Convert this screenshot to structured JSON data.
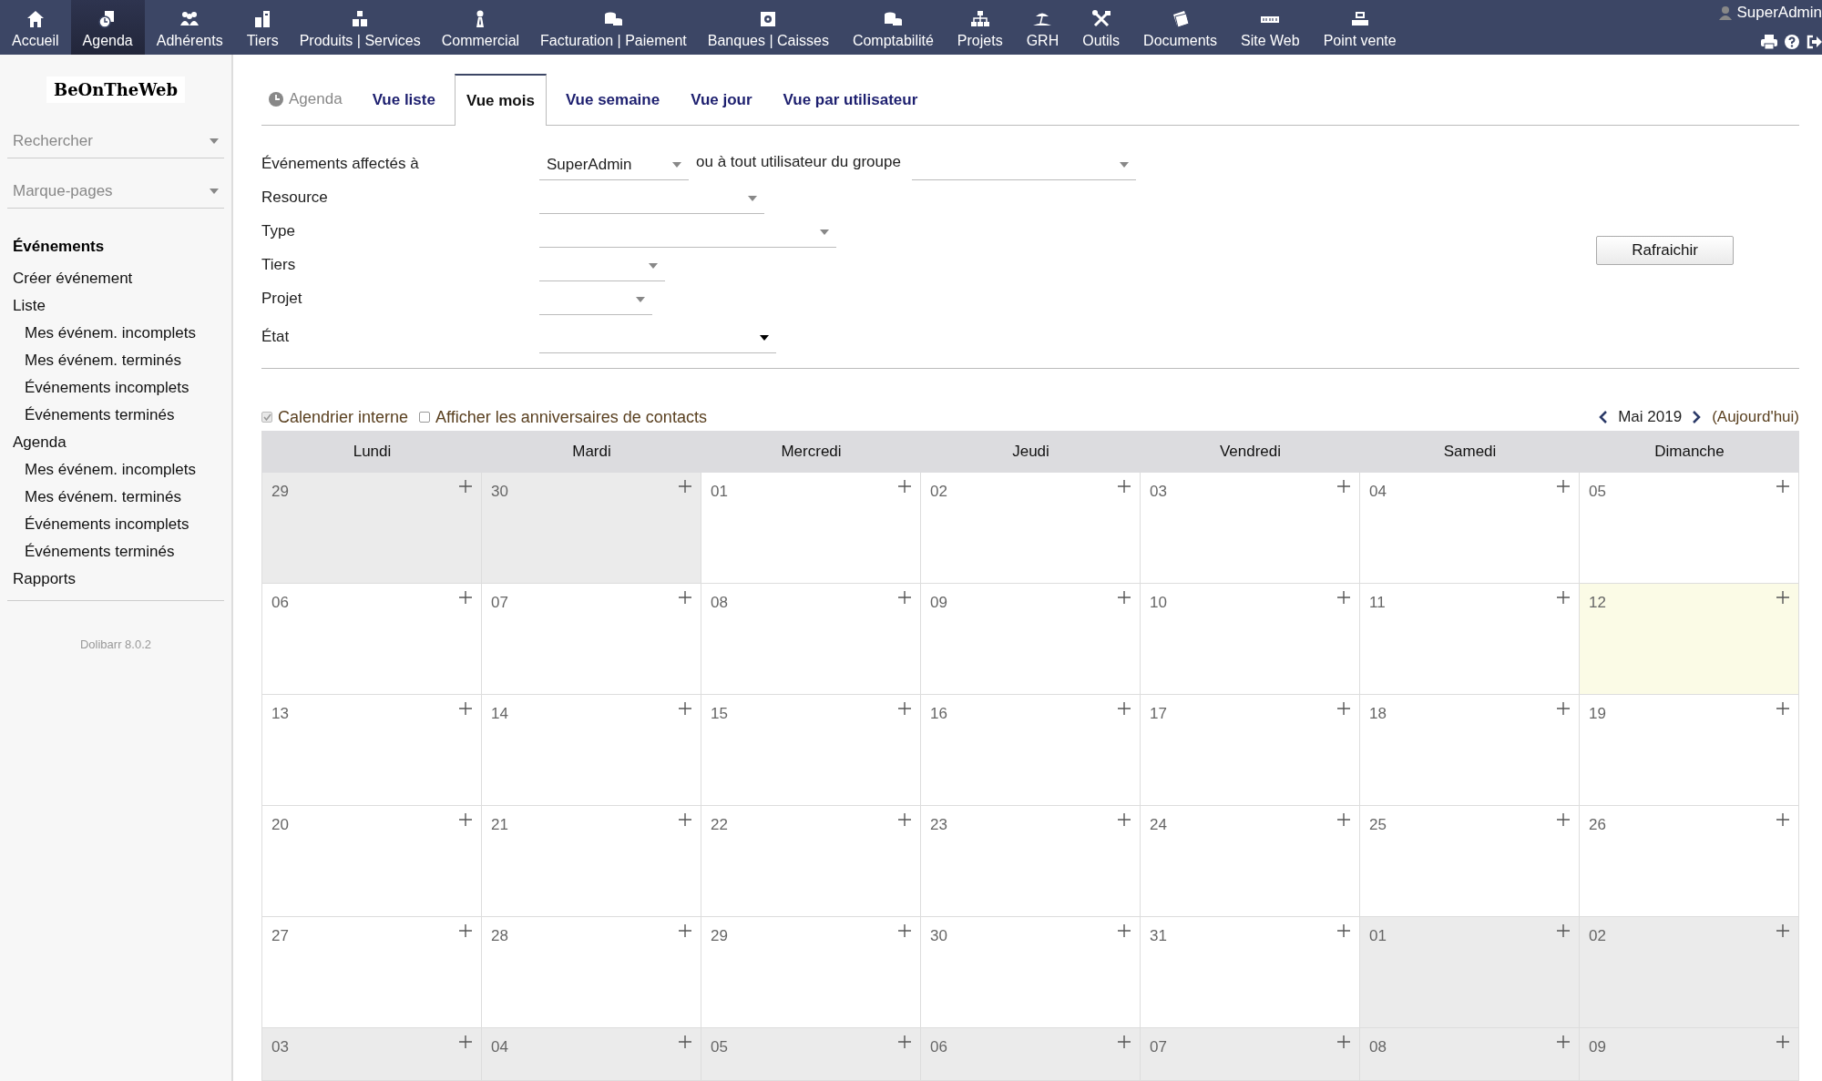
{
  "top_menu": [
    {
      "label": "Accueil",
      "selected": false
    },
    {
      "label": "Agenda",
      "selected": true
    },
    {
      "label": "Adhérents",
      "selected": false
    },
    {
      "label": "Tiers",
      "selected": false
    },
    {
      "label": "Produits | Services",
      "selected": false
    },
    {
      "label": "Commercial",
      "selected": false
    },
    {
      "label": "Facturation | Paiement",
      "selected": false
    },
    {
      "label": "Banques | Caisses",
      "selected": false
    },
    {
      "label": "Comptabilité",
      "selected": false
    },
    {
      "label": "Projets",
      "selected": false
    },
    {
      "label": "GRH",
      "selected": false
    },
    {
      "label": "Outils",
      "selected": false
    },
    {
      "label": "Documents",
      "selected": false
    },
    {
      "label": "Site Web",
      "selected": false
    },
    {
      "label": "Point vente",
      "selected": false
    }
  ],
  "user": {
    "name": "SuperAdmin"
  },
  "sidebar": {
    "logo": "BeOnTheWeb",
    "search": {
      "placeholder": "Rechercher"
    },
    "bookmarks": {
      "placeholder": "Marque-pages"
    },
    "heading": "Événements",
    "items": [
      {
        "label": "Créer événement"
      },
      {
        "label": "Liste",
        "children": [
          {
            "label": "Mes événem. incomplets"
          },
          {
            "label": "Mes événem. terminés"
          },
          {
            "label": "Événements incomplets"
          },
          {
            "label": "Événements terminés"
          }
        ]
      },
      {
        "label": "Agenda",
        "children": [
          {
            "label": "Mes événem. incomplets"
          },
          {
            "label": "Mes événem. terminés"
          },
          {
            "label": "Événements incomplets"
          },
          {
            "label": "Événements terminés"
          }
        ]
      },
      {
        "label": "Rapports"
      }
    ],
    "version": "Dolibarr 8.0.2"
  },
  "tabs_title": "Agenda",
  "tabs": [
    {
      "label": "Vue liste",
      "selected": false
    },
    {
      "label": "Vue mois",
      "selected": true
    },
    {
      "label": "Vue semaine",
      "selected": false
    },
    {
      "label": "Vue jour",
      "selected": false
    },
    {
      "label": "Vue par utilisateur",
      "selected": false
    }
  ],
  "filters": [
    {
      "label": "Événements affectés à",
      "value": "SuperAdmin",
      "extra_label": "ou à tout utilisateur du groupe"
    },
    {
      "label": "Resource"
    },
    {
      "label": "Type"
    },
    {
      "label": "Tiers"
    },
    {
      "label": "Projet"
    },
    {
      "label": "État"
    }
  ],
  "refresh_button": "Rafraichir",
  "options": [
    {
      "label": "Calendrier interne",
      "checked": true,
      "disabled": true
    },
    {
      "label": "Afficher les anniversaires de contacts",
      "checked": false,
      "disabled": false
    }
  ],
  "month_nav": {
    "month": "Mai 2019",
    "today_link": "(Aujourd'hui)"
  },
  "calendar": {
    "weekdays": [
      "Lundi",
      "Mardi",
      "Mercredi",
      "Jeudi",
      "Vendredi",
      "Samedi",
      "Dimanche"
    ],
    "weeks": [
      [
        {
          "day": "29",
          "kind": "other"
        },
        {
          "day": "30",
          "kind": "other"
        },
        {
          "day": "01",
          "kind": "current"
        },
        {
          "day": "02",
          "kind": "current"
        },
        {
          "day": "03",
          "kind": "current"
        },
        {
          "day": "04",
          "kind": "current"
        },
        {
          "day": "05",
          "kind": "current"
        }
      ],
      [
        {
          "day": "06",
          "kind": "current"
        },
        {
          "day": "07",
          "kind": "current"
        },
        {
          "day": "08",
          "kind": "current"
        },
        {
          "day": "09",
          "kind": "current"
        },
        {
          "day": "10",
          "kind": "current"
        },
        {
          "day": "11",
          "kind": "current"
        },
        {
          "day": "12",
          "kind": "today"
        }
      ],
      [
        {
          "day": "13",
          "kind": "current"
        },
        {
          "day": "14",
          "kind": "current"
        },
        {
          "day": "15",
          "kind": "current"
        },
        {
          "day": "16",
          "kind": "current"
        },
        {
          "day": "17",
          "kind": "current"
        },
        {
          "day": "18",
          "kind": "current"
        },
        {
          "day": "19",
          "kind": "current"
        }
      ],
      [
        {
          "day": "20",
          "kind": "current"
        },
        {
          "day": "21",
          "kind": "current"
        },
        {
          "day": "22",
          "kind": "current"
        },
        {
          "day": "23",
          "kind": "current"
        },
        {
          "day": "24",
          "kind": "current"
        },
        {
          "day": "25",
          "kind": "current"
        },
        {
          "day": "26",
          "kind": "current"
        }
      ],
      [
        {
          "day": "27",
          "kind": "current"
        },
        {
          "day": "28",
          "kind": "current"
        },
        {
          "day": "29",
          "kind": "current"
        },
        {
          "day": "30",
          "kind": "current"
        },
        {
          "day": "31",
          "kind": "current"
        },
        {
          "day": "01",
          "kind": "other"
        },
        {
          "day": "02",
          "kind": "other"
        }
      ],
      [
        {
          "day": "03",
          "kind": "other"
        },
        {
          "day": "04",
          "kind": "other"
        },
        {
          "day": "05",
          "kind": "other"
        },
        {
          "day": "06",
          "kind": "other"
        },
        {
          "day": "07",
          "kind": "other"
        },
        {
          "day": "08",
          "kind": "other"
        },
        {
          "day": "09",
          "kind": "other"
        }
      ]
    ]
  }
}
